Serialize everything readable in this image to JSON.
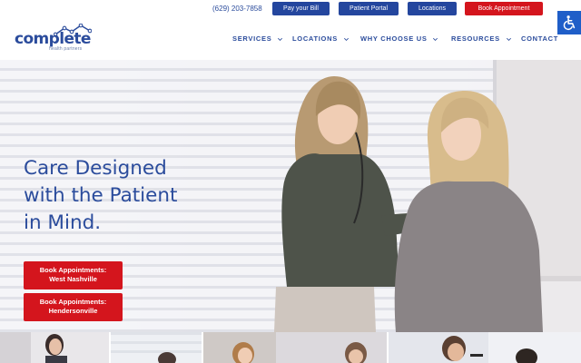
{
  "header": {
    "logo": {
      "word": "complete",
      "tagline": "health partners"
    },
    "phone": "(629) 203-7858",
    "top_buttons": {
      "pay_bill": "Pay your Bill",
      "patient_portal": "Patient Portal",
      "locations": "Locations",
      "book_appointment": "Book Appointment"
    },
    "nav": {
      "services": "SERVICES",
      "locations": "LOCATIONS",
      "why_choose_us": "WHY CHOOSE US",
      "resources": "RESOURCES",
      "contact": "CONTACT"
    }
  },
  "hero": {
    "title_lines": [
      "Care Designed",
      "with the Patient",
      "in Mind."
    ],
    "cta_west": {
      "line1": "Book Appointments:",
      "line2": "West Nashville"
    },
    "cta_henderson": {
      "line1": "Book Appointments:",
      "line2": "Hendersonville"
    }
  },
  "icons": {
    "accessibility": "wheelchair-icon",
    "dropdown": "chevron-down-icon"
  },
  "colors": {
    "brand_blue": "#2b4c9c",
    "button_blue": "#24469e",
    "cta_red": "#d4151d",
    "accessibility_blue": "#1f5ec8"
  }
}
